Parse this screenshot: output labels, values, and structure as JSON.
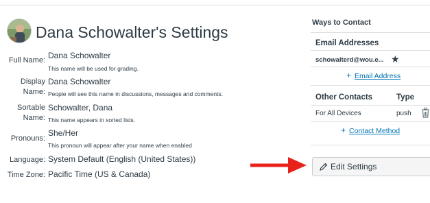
{
  "header": {
    "title": "Dana Schowalter's Settings"
  },
  "profile": {
    "full_name": {
      "label": "Full Name:",
      "value": "Dana Schowalter",
      "hint": "This name will be used for grading."
    },
    "display_name": {
      "label_line1": "Display",
      "label_line2": "Name:",
      "value": "Dana Schowalter",
      "hint": "People will see this name in discussions, messages and comments."
    },
    "sortable_name": {
      "label_line1": "Sortable",
      "label_line2": "Name:",
      "value": "Schowalter, Dana",
      "hint": "This name appears in sorted lists."
    },
    "pronouns": {
      "label": "Pronouns:",
      "value": "She/Her",
      "hint": "This pronoun will appear after your name when enabled"
    },
    "language": {
      "label": "Language:",
      "value": "System Default (English (United States))"
    },
    "time_zone": {
      "label": "Time Zone:",
      "value": "Pacific Time (US & Canada)"
    }
  },
  "sidebar": {
    "title": "Ways to Contact",
    "email": {
      "heading": "Email Addresses",
      "address": "schowalterd@wou.e...",
      "add_link": "Email Address"
    },
    "other_contacts": {
      "heading": "Other Contacts",
      "type_heading": "Type",
      "row_name": "For All Devices",
      "row_type": "push",
      "add_link": "Contact Method"
    },
    "edit_button": "Edit Settings"
  },
  "colors": {
    "text": "#2d3b45",
    "link": "#0374b5",
    "arrow": "#e8221b",
    "rule": "#dcdfe2"
  }
}
